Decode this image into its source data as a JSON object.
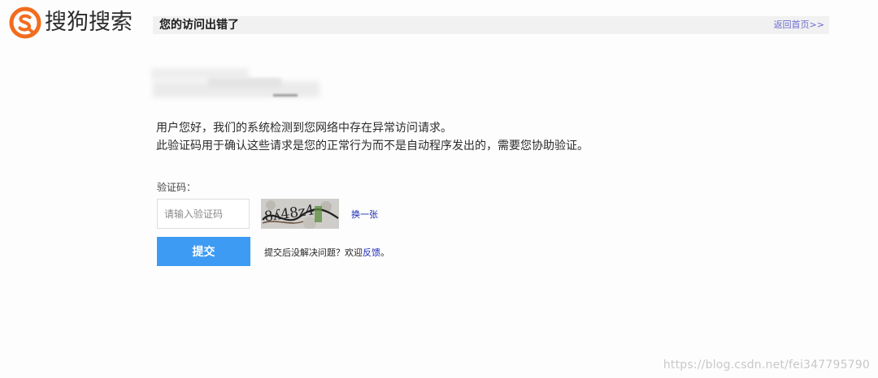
{
  "header": {
    "logo_text": "搜狗搜索",
    "title": "您的访问出错了",
    "home_link": "返回首页>>"
  },
  "message": {
    "line1": "用户您好，我们的系统检测到您网络中存在异常访问请求。",
    "line2": "此验证码用于确认这些请求是您的正常行为而不是自动程序发出的，需要您协助验证。"
  },
  "form": {
    "captcha_label": "验证码：",
    "captcha_placeholder": "请输入验证码",
    "captcha_image_text": "8ʎ48z4",
    "refresh_link": "换一张",
    "submit_label": "提交",
    "feedback_prefix": "提交后没解决问题？欢迎",
    "feedback_link": "反馈",
    "feedback_suffix": "。"
  },
  "watermark": "https://blog.csdn.net/fei347795790",
  "colors": {
    "brand_orange": "#f26c1e",
    "submit_blue": "#3d9bf4",
    "link_blue": "#1c2bb5"
  },
  "icons": {
    "logo": "sogou-s-logo-icon"
  }
}
